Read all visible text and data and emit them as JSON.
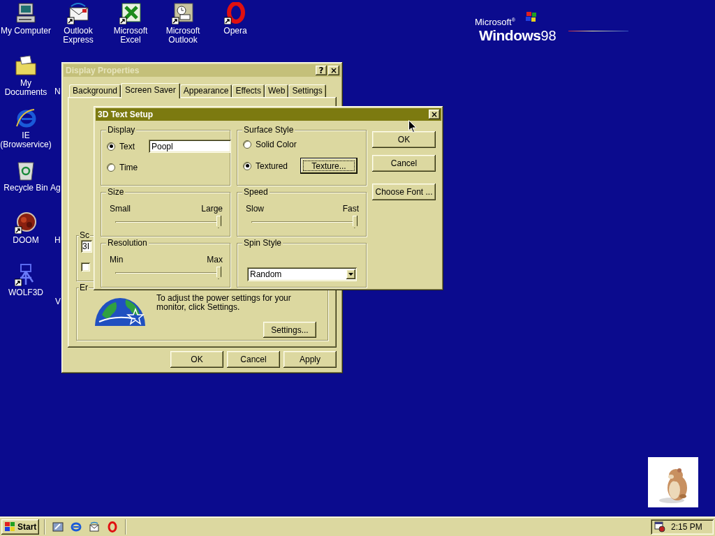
{
  "desktop": {
    "icons": [
      {
        "label": "My Computer",
        "kind": "computer"
      },
      {
        "label": "Outlook Express",
        "kind": "mail"
      },
      {
        "label": "Microsoft Excel",
        "kind": "sheet"
      },
      {
        "label": "Microsoft Outlook",
        "kind": "clock"
      },
      {
        "label": "Opera",
        "kind": "ring"
      },
      {
        "label": "My Documents",
        "kind": "folder"
      },
      {
        "label": "N",
        "kind": "hidden"
      },
      {
        "label": "IE (Browservice)",
        "kind": "browser"
      },
      {
        "label": "Recycle Bin",
        "kind": "bin"
      },
      {
        "label": "Ag",
        "kind": "hidden"
      },
      {
        "label": "DOOM",
        "kind": "disc"
      },
      {
        "label": "H",
        "kind": "hidden"
      },
      {
        "label": "WOLF3D",
        "kind": "emblem"
      },
      {
        "label": "V",
        "kind": "hidden"
      }
    ],
    "logo": {
      "brand": "Microsoft$^{®}$",
      "product": "Windows",
      "version": "98"
    }
  },
  "display_properties": {
    "title": "Display Properties",
    "active": false,
    "title_buttons": [
      "?",
      "×"
    ],
    "tabs": [
      {
        "label": "Background",
        "selected": false
      },
      {
        "label": "Screen Saver",
        "selected": true
      },
      {
        "label": "Appearance",
        "selected": false
      },
      {
        "label": "Effects",
        "selected": false
      },
      {
        "label": "Web",
        "selected": false
      },
      {
        "label": "Settings",
        "selected": false
      }
    ],
    "screen_saver": {
      "label": "Sc",
      "value": "3I",
      "checkbox": {
        "checked": false
      }
    },
    "energy": {
      "label": "Er",
      "text": "To adjust the power settings for your monitor, click Settings.",
      "button": "Settings..."
    },
    "buttons": [
      "OK",
      "Cancel",
      "Apply"
    ]
  },
  "text_setup": {
    "title": "3D Text Setup",
    "active": true,
    "close": "×",
    "display": {
      "label": "Display",
      "options": [
        {
          "label": "Text",
          "selected": true
        },
        {
          "label": "Time",
          "selected": false
        }
      ],
      "text_value": "Poopl"
    },
    "surface": {
      "label": "Surface Style",
      "options": [
        {
          "label": "Solid Color",
          "selected": false
        },
        {
          "label": "Textured",
          "selected": true
        }
      ],
      "texture_button": "Texture..."
    },
    "size": {
      "label": "Size",
      "min": "Small",
      "max": "Large",
      "level": 1
    },
    "speed": {
      "label": "Speed",
      "min": "Slow",
      "max": "Fast",
      "level": 1
    },
    "resolution": {
      "label": "Resolution",
      "min": "Min",
      "max": "Max",
      "level": 1
    },
    "spin": {
      "label": "Spin Style",
      "value": "Random"
    },
    "buttons": [
      "OK",
      "Cancel",
      "Choose Font ..."
    ]
  },
  "taskbar": {
    "start": "Start",
    "quick_launch": [
      {
        "kind": "desktop"
      },
      {
        "kind": "browser"
      },
      {
        "kind": "mail"
      },
      {
        "kind": "ring"
      }
    ],
    "clock": "2:15 PM"
  }
}
